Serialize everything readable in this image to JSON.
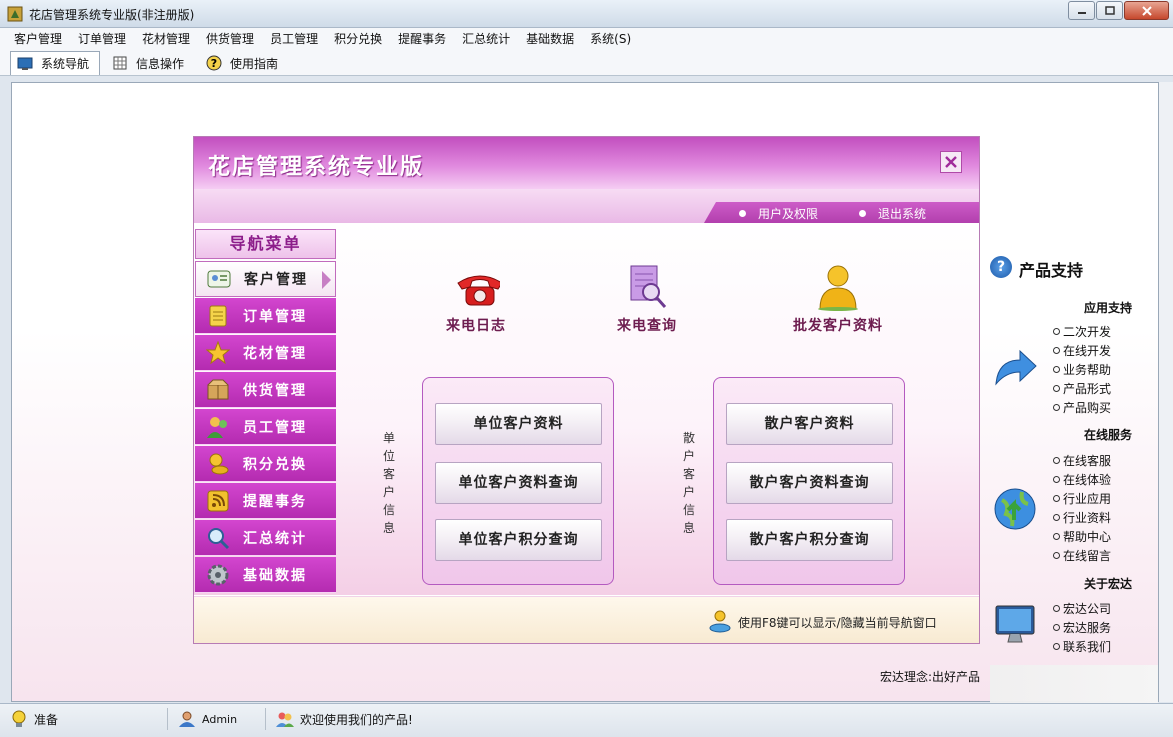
{
  "window": {
    "title": "花店管理系统专业版(非注册版)"
  },
  "menubar": [
    "客户管理",
    "订单管理",
    "花材管理",
    "供货管理",
    "员工管理",
    "积分兑换",
    "提醒事务",
    "汇总统计",
    "基础数据",
    "系统(S)"
  ],
  "toolbar": [
    {
      "label": "系统导航",
      "icon": "monitor-icon",
      "active": true
    },
    {
      "label": "信息操作",
      "icon": "grid-icon",
      "active": false
    },
    {
      "label": "使用指南",
      "icon": "help-icon",
      "active": false
    }
  ],
  "nav": {
    "title": "花店管理系统专业版",
    "links": {
      "user_rights": "用户及权限",
      "exit": "退出系统"
    },
    "side_title": "导航菜单",
    "side_items": [
      {
        "label": "客户管理",
        "icon": "contact-card-icon",
        "active": true
      },
      {
        "label": "订单管理",
        "icon": "notepad-icon",
        "active": false
      },
      {
        "label": "花材管理",
        "icon": "star-icon",
        "active": false
      },
      {
        "label": "供货管理",
        "icon": "box-icon",
        "active": false
      },
      {
        "label": "员工管理",
        "icon": "people-icon",
        "active": false
      },
      {
        "label": "积分兑换",
        "icon": "coins-icon",
        "active": false
      },
      {
        "label": "提醒事务",
        "icon": "rss-icon",
        "active": false
      },
      {
        "label": "汇总统计",
        "icon": "magnifier-icon",
        "active": false
      },
      {
        "label": "基础数据",
        "icon": "gear-icon",
        "active": false
      }
    ],
    "quick": [
      {
        "label": "来电日志",
        "icon": "telephone-icon"
      },
      {
        "label": "来电查询",
        "icon": "search-document-icon"
      },
      {
        "label": "批发客户资料",
        "icon": "user-icon"
      }
    ],
    "group_unit": {
      "vertical_label": [
        "单",
        "位",
        "客",
        "户",
        "信",
        "息"
      ],
      "buttons": [
        "单位客户资料",
        "单位客户资料查询",
        "单位客户积分查询"
      ]
    },
    "group_retail": {
      "vertical_label": [
        "散",
        "户",
        "客",
        "户",
        "信",
        "息"
      ],
      "buttons": [
        "散户客户资料",
        "散户客户资料查询",
        "散户客户积分查询"
      ]
    },
    "footer_tip": "使用F8键可以显示/隐藏当前导航窗口"
  },
  "support": {
    "title": "产品支持",
    "sections": [
      {
        "title": "应用支持",
        "icon": "arrow-icon",
        "links": [
          "二次开发",
          "在线开发",
          "业务帮助",
          "产品形式",
          "产品购买"
        ]
      },
      {
        "title": "在线服务",
        "icon": "globe-icon",
        "links": [
          "在线客服",
          "在线体验",
          "行业应用",
          "行业资料",
          "帮助中心",
          "在线留言"
        ]
      },
      {
        "title": "关于宏达",
        "icon": "monitor-screen-icon",
        "links": [
          "宏达公司",
          "宏达服务",
          "联系我们"
        ]
      }
    ],
    "motto": "宏达理念:出好产品"
  },
  "status": {
    "ready": "准备",
    "user": "Admin",
    "welcome": "欢迎使用我们的产品!"
  },
  "colors": {
    "accent": "#c73fc2",
    "header": "#d96ad6",
    "side_item": "#c23abf"
  }
}
